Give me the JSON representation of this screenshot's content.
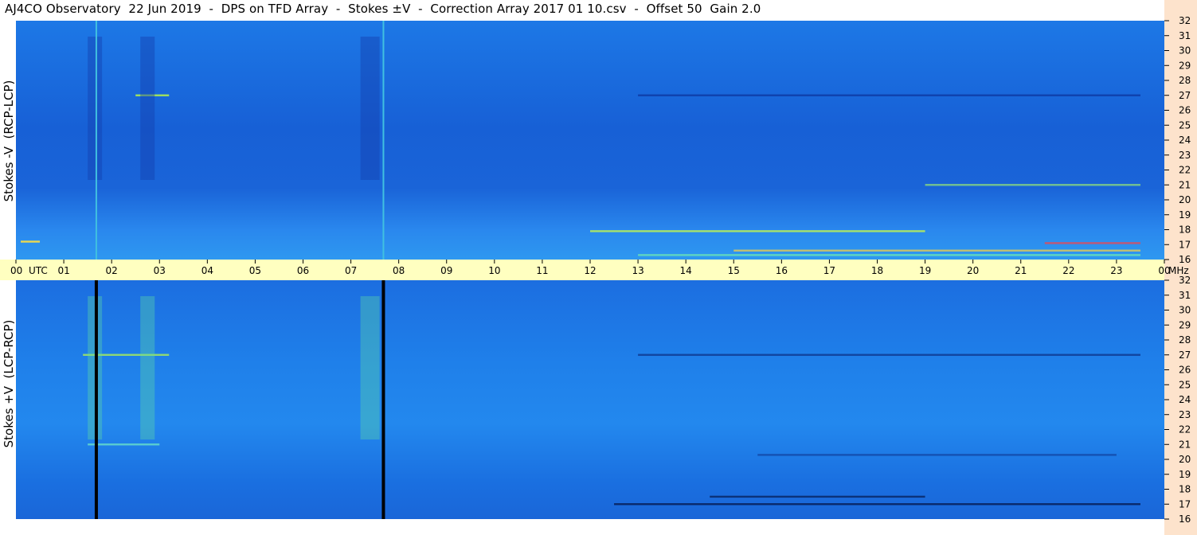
{
  "title": "AJ4CO Observatory  22 Jun 2019  -  DPS on TFD Array  -  Stokes ±V  -  Correction Array 2017 01 10.csv  -  Offset 50  Gain 2.0",
  "colors": {
    "background": "#ffffff",
    "axis_band": "#ffffc0",
    "side_strip": "#fde3cc",
    "panel_base": "#1a6fe0"
  },
  "chart_data": [
    {
      "type": "heatmap",
      "panel": "top",
      "ylabel": "Stokes -V  (RCP-LCP)",
      "x_range_utc_hours": [
        0,
        24
      ],
      "y_range_mhz": [
        16,
        32
      ],
      "y_ticks": [
        "32",
        "31",
        "30",
        "29",
        "28",
        "27",
        "26",
        "25",
        "24",
        "23",
        "22",
        "21",
        "20",
        "19",
        "18",
        "17",
        "16"
      ],
      "vertical_lines_utc": [
        1.68,
        7.68
      ],
      "vertical_line_color": "#40c0e0"
    },
    {
      "type": "heatmap",
      "panel": "bottom",
      "ylabel": "Stokes +V  (LCP-RCP)",
      "x_range_utc_hours": [
        0,
        24
      ],
      "y_range_mhz": [
        16,
        32
      ],
      "y_ticks": [
        "32",
        "31",
        "30",
        "29",
        "28",
        "27",
        "26",
        "25",
        "24",
        "23",
        "22",
        "21",
        "20",
        "19",
        "18",
        "17",
        "16"
      ],
      "vertical_lines_utc": [
        1.68,
        7.68
      ],
      "vertical_line_color": "#000000"
    }
  ],
  "x_axis": {
    "tick_labels": [
      "00",
      "01",
      "02",
      "03",
      "04",
      "05",
      "06",
      "07",
      "08",
      "09",
      "10",
      "11",
      "12",
      "13",
      "14",
      "15",
      "16",
      "17",
      "18",
      "19",
      "20",
      "21",
      "22",
      "23",
      "00"
    ],
    "utc_label": "UTC",
    "unit": "MHz"
  }
}
